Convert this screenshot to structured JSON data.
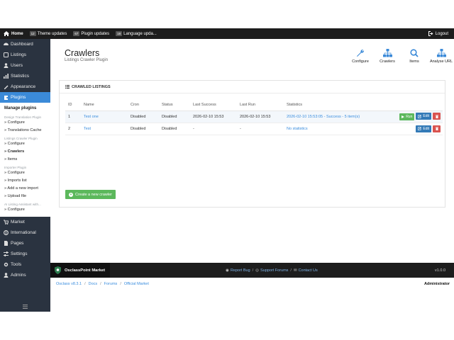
{
  "topbar": {
    "home": "Home",
    "theme_updates_count": "12",
    "theme_updates": "Theme updates",
    "plugin_updates_count": "67",
    "plugin_updates": "Plugin updates",
    "language_updates_count": "18",
    "language_updates": "Language upda...",
    "logout": "Logout"
  },
  "sidebar": {
    "items": [
      {
        "label": "Dashboard",
        "icon": "dashboard-icon"
      },
      {
        "label": "Listings",
        "icon": "listings-icon"
      },
      {
        "label": "Users",
        "icon": "users-icon"
      },
      {
        "label": "Statistics",
        "icon": "statistics-icon"
      },
      {
        "label": "Appearance",
        "icon": "appearance-icon"
      },
      {
        "label": "Plugins",
        "icon": "plugins-icon"
      },
      {
        "label": "Market",
        "icon": "market-icon"
      },
      {
        "label": "International",
        "icon": "globe-icon"
      },
      {
        "label": "Pages",
        "icon": "pages-icon"
      },
      {
        "label": "Settings",
        "icon": "settings-icon"
      },
      {
        "label": "Tools",
        "icon": "tools-icon"
      },
      {
        "label": "Admins",
        "icon": "admins-icon"
      }
    ],
    "submenu": {
      "head": "Manage plugins",
      "group1": "Design Translation Plugin",
      "g1_configure": "» Configure",
      "g1_cache": "» Translations Cache",
      "group2": "Listings Crawler Plugin",
      "g2_configure": "» Configure",
      "g2_crawlers": "» Crawlers",
      "g2_items": "» Items",
      "group3": "Importer Plugin",
      "g3_configure": "» Configure",
      "g3_imports": "» Imports list",
      "g3_add": "» Add a new import",
      "g3_upload": "» Upload file",
      "group4": "AI Listing Assistant with...",
      "g4_configure": "» Configure"
    }
  },
  "header": {
    "title": "Crawlers",
    "subtitle": "Listings Crawler Plugin",
    "actions": [
      {
        "label": "Configure",
        "icon": "wrench-icon"
      },
      {
        "label": "Crawlers",
        "icon": "sitemap-icon"
      },
      {
        "label": "Items",
        "icon": "search-icon"
      },
      {
        "label": "Analyse URL",
        "icon": "sitemap-icon"
      }
    ]
  },
  "table": {
    "title": "CRAWLED LISTINGS",
    "columns": [
      "ID",
      "Name",
      "Cron",
      "Status",
      "Last Success",
      "Last Run",
      "Statistics"
    ],
    "rows": [
      {
        "id": "1",
        "name": "Test one",
        "cron": "Disabled",
        "status": "Disabled",
        "last_success": "2026-02-10 15:53",
        "last_run": "2026-02-10 15:53",
        "statistics": "2026-02-10 15:53:05 - Success - 5 item(s)",
        "run": "Run",
        "edit": "Edit"
      },
      {
        "id": "2",
        "name": "Test",
        "cron": "Disabled",
        "status": "Disabled",
        "last_success": "-",
        "last_run": "-",
        "statistics": "No statistics",
        "edit": "Edit"
      }
    ],
    "new_button": "Create a new crawler"
  },
  "footer": {
    "brand": "OsclassPoint Market",
    "report_bug": "Report Bug",
    "support_forums": "Support Forums",
    "contact_us": "Contact Us",
    "version": "v1.0.0"
  },
  "bottombar": {
    "crumbs": [
      "Osclass v8.3.1",
      "Docs",
      "Forums",
      "Official Market"
    ],
    "admin": "Administrator"
  },
  "colors": {
    "topbar": "#1d1d1d",
    "sidebar": "#2a3340",
    "active": "#3b8ad8",
    "success": "#5cb85c",
    "primary": "#337ab7",
    "danger": "#d9534f",
    "link": "#3a8dde"
  }
}
